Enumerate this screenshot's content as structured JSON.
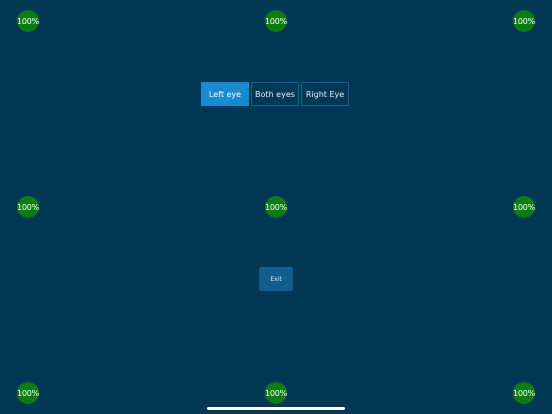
{
  "badges": {
    "top_left": "100%",
    "top_center": "100%",
    "top_right": "100%",
    "middle_left": "100%",
    "middle_center": "100%",
    "middle_right": "100%",
    "bottom_left": "100%",
    "bottom_center": "100%",
    "bottom_right": "100%"
  },
  "eye_selector": {
    "left": "Left eye",
    "both": "Both eyes",
    "right": "Right Eye",
    "selected": "Left eye"
  },
  "exit_label": "Exit",
  "colors": {
    "background": "#033756",
    "badge": "#0d7a12",
    "selected_segment": "#1a8ad0",
    "exit_button": "#125f8f"
  }
}
